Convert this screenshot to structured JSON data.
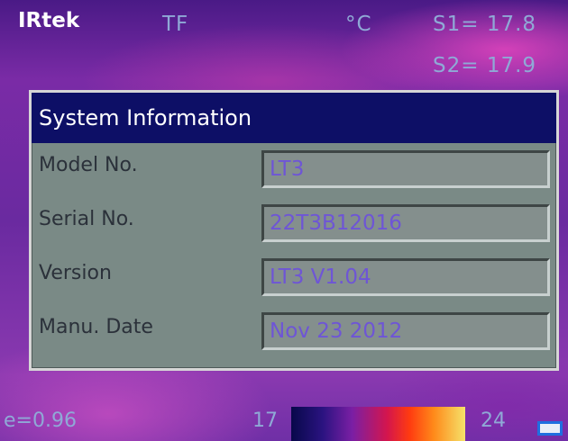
{
  "hud": {
    "brand": "IRtek",
    "mode": "TF",
    "unit": "°C",
    "spot1": "S1= 17.8",
    "spot2": "S2= 17.9"
  },
  "dialog": {
    "title": "System Information",
    "rows": [
      {
        "label": "Model No.",
        "value": "LT3"
      },
      {
        "label": "Serial No.",
        "value": "22T3B12016"
      },
      {
        "label": "Version",
        "value": "LT3 V1.04"
      },
      {
        "label": "Manu. Date",
        "value": "Nov 23 2012"
      }
    ]
  },
  "status": {
    "emissivity": "e=0.96",
    "scale_min": "17",
    "scale_max": "24",
    "battery_icon": "battery-icon"
  },
  "colors": {
    "header_bg": "#0d0f66",
    "panel_bg": "#7a8a86",
    "field_text": "#6e55d6",
    "hud_text": "#8fa9d6"
  }
}
